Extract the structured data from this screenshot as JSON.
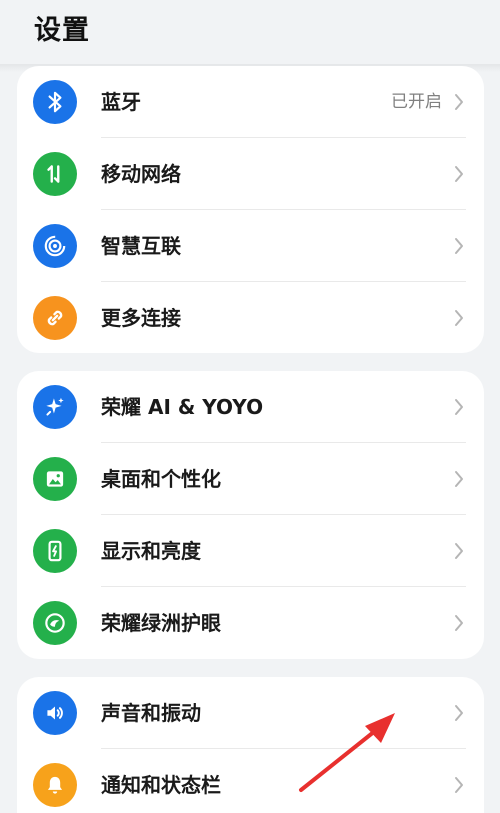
{
  "header": {
    "title": "设置"
  },
  "groups": [
    {
      "items": [
        {
          "label": "蓝牙",
          "value": "已开启",
          "icon": "bluetooth-icon",
          "color": "#1a73e8"
        },
        {
          "label": "移动网络",
          "value": "",
          "icon": "mobile-data-icon",
          "color": "#24b04b"
        },
        {
          "label": "智慧互联",
          "value": "",
          "icon": "smart-connect-icon",
          "color": "#1a73e8"
        },
        {
          "label": "更多连接",
          "value": "",
          "icon": "link-icon",
          "color": "#f7931e"
        }
      ]
    },
    {
      "items": [
        {
          "label": "荣耀 AI & YOYO",
          "value": "",
          "icon": "sparkle-icon",
          "color": "#1a73e8"
        },
        {
          "label": "桌面和个性化",
          "value": "",
          "icon": "image-icon",
          "color": "#24b04b"
        },
        {
          "label": "显示和亮度",
          "value": "",
          "icon": "display-brightness-icon",
          "color": "#24b04b"
        },
        {
          "label": "荣耀绿洲护眼",
          "value": "",
          "icon": "eye-comfort-icon",
          "color": "#24b04b"
        }
      ]
    },
    {
      "items": [
        {
          "label": "声音和振动",
          "value": "",
          "icon": "speaker-icon",
          "color": "#1a73e8"
        },
        {
          "label": "通知和状态栏",
          "value": "",
          "icon": "bell-icon",
          "color": "#f7a21b"
        }
      ]
    }
  ],
  "annotation": {
    "arrow_color": "#e8302e"
  }
}
